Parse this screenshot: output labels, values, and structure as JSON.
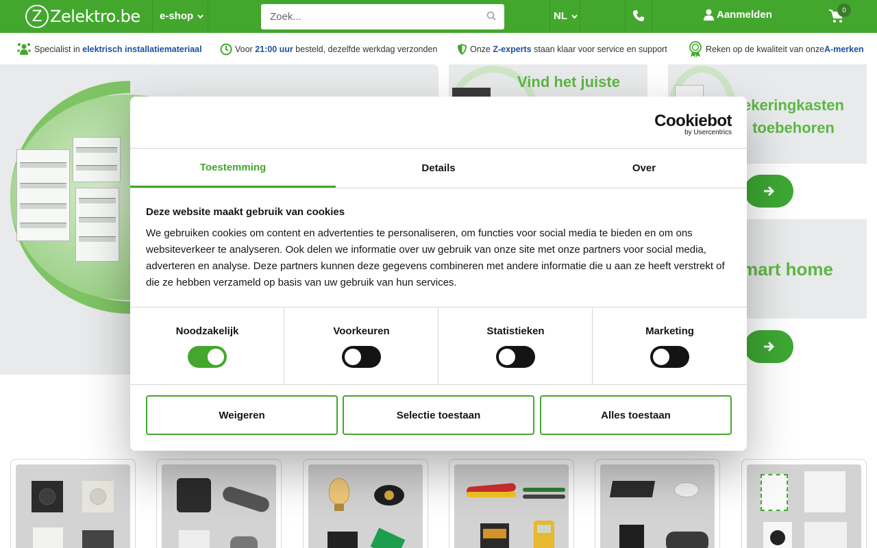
{
  "header": {
    "logo_letter": "Z",
    "logo_text": "Zelektro.be",
    "eshop_label": "e-shop",
    "search_placeholder": "Zoek...",
    "language": "NL",
    "login_label": "Aanmelden",
    "cart_count": "0"
  },
  "usp": [
    {
      "pre": "Specialist in ",
      "bold": "elektrisch installatiemateriaal",
      "post": "",
      "icon": "people-icon"
    },
    {
      "pre": "Voor ",
      "bold": "21:00 uur",
      "post": " besteld, dezelfde werkdag verzonden",
      "icon": "clock-icon"
    },
    {
      "pre": "Onze ",
      "bold": "Z-experts",
      "post": " staan klaar voor service en support",
      "icon": "shield-icon"
    },
    {
      "pre": "Reken op de kwaliteit van onze ",
      "bold": "A-merken",
      "post": "",
      "icon": "award-icon"
    }
  ],
  "promo": {
    "card_top_title": "Vind het juiste",
    "card1_title_line1": "ekeringkasten",
    "card1_title_line2": "toebehoren",
    "card2_title": "mart home"
  },
  "cookie_dialog": {
    "brand": "Cookiebot",
    "brand_sub": "by Usercentrics",
    "tabs": [
      "Toestemming",
      "Details",
      "Over"
    ],
    "active_tab": "Toestemming",
    "heading": "Deze website maakt gebruik van cookies",
    "body": "We gebruiken cookies om content en advertenties te personaliseren, om functies voor social media te bieden en om ons websiteverkeer te analyseren. Ook delen we informatie over uw gebruik van onze site met onze partners voor social media, adverteren en analyse. Deze partners kunnen deze gegevens combineren met andere informatie die u aan ze heeft verstrekt of die ze hebben verzameld op basis van uw gebruik van hun services.",
    "toggles": [
      {
        "label": "Noodzakelijk",
        "on": true
      },
      {
        "label": "Voorkeuren",
        "on": false
      },
      {
        "label": "Statistieken",
        "on": false
      },
      {
        "label": "Marketing",
        "on": false
      }
    ],
    "buttons": {
      "deny": "Weigeren",
      "selection": "Selectie toestaan",
      "all": "Alles toestaan"
    }
  },
  "colors": {
    "brand_green": "#43a72e",
    "link_blue": "#1f4e9e",
    "dark": "#141414"
  }
}
